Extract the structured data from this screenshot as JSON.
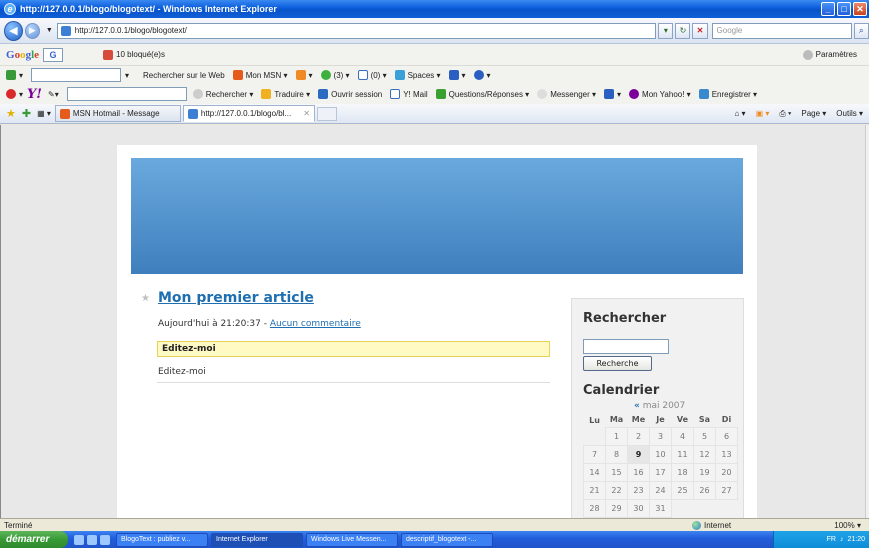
{
  "window": {
    "title": "http://127.0.0.1/blogo/blogotext/ - Windows Internet Explorer",
    "controls": [
      "_",
      "□",
      "✕"
    ]
  },
  "address_bar": {
    "url": "http://127.0.0.1/blogo/blogotext/",
    "search_placeholder": "Google"
  },
  "google_toolbar": {
    "logo": "Google",
    "g_button": "G",
    "blocked": "10 bloqué(e)s",
    "settings": "Paramètres"
  },
  "msn_toolbar": {
    "search_web": "Rechercher sur le Web",
    "mon_msn": "Mon MSN",
    "mail_count": "(3)",
    "inbox_count": "(0)",
    "spaces": "Spaces"
  },
  "yahoo_toolbar": {
    "logo": "Y!",
    "search": "Rechercher",
    "translate": "Traduire",
    "login": "Ouvrir session",
    "mail": "Y! Mail",
    "qa": "Questions/Réponses",
    "messenger": "Messenger",
    "my_yahoo": "Mon Yahoo!",
    "save": "Enregistrer"
  },
  "tabs": [
    {
      "label": "MSN Hotmail - Message"
    },
    {
      "label": "http://127.0.0.1/blogo/bl..."
    }
  ],
  "command_bar": {
    "page": "Page",
    "tools": "Outils"
  },
  "blog": {
    "post_title": "Mon premier article",
    "post_meta_prefix": "Aujourd'hui à 21:20:37 - ",
    "post_meta_link": "Aucun commentaire",
    "highlight_text": "Editez-moi",
    "body_text": "Editez-moi"
  },
  "sidebar": {
    "search_heading": "Rechercher",
    "search_button": "Recherche",
    "calendar_heading": "Calendrier",
    "month_prev": "«",
    "month_label": "mai 2007",
    "weekdays": [
      "Lu",
      "Ma",
      "Me",
      "Je",
      "Ve",
      "Sa",
      "Di"
    ],
    "weeks": [
      [
        "",
        "1",
        "2",
        "3",
        "4",
        "5",
        "6"
      ],
      [
        "7",
        "8",
        "9",
        "10",
        "11",
        "12",
        "13"
      ],
      [
        "14",
        "15",
        "16",
        "17",
        "18",
        "19",
        "20"
      ],
      [
        "21",
        "22",
        "23",
        "24",
        "25",
        "26",
        "27"
      ],
      [
        "28",
        "29",
        "30",
        "31",
        "",
        "",
        ""
      ]
    ],
    "today": "9"
  },
  "status_bar": {
    "status": "Terminé",
    "zone": "Internet",
    "zoom": "100%"
  },
  "taskbar": {
    "start": "démarrer",
    "tasks": [
      "BlogoText : publiez v...",
      "Internet Explorer",
      "Windows Live Messen...",
      "descriptif_blogotext -..."
    ],
    "lang": "FR",
    "clock": "21:20"
  }
}
